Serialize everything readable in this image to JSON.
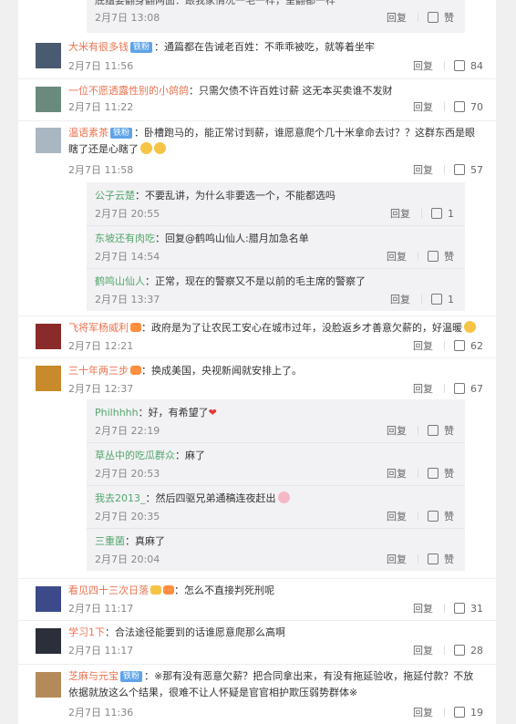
{
  "like_label": "赞",
  "reply_label": "回复",
  "top_partial": {
    "text": "底蕴要翻身翻两面：跟我家情况一毛一样，呈翻都一样",
    "date": "2月7日 13:08"
  },
  "comments": [
    {
      "name": "大米有很多钱",
      "badge": "铁粉",
      "text": "：通篇都在告诫老百姓：不乖乖被吃，就等着坐牢",
      "date": "2月7日 11:56",
      "likes": "84",
      "avatar_color": "#4a5a70"
    },
    {
      "name": "一位不愿透露性别的小鸽鸽",
      "badge": "",
      "text": "：只需欠债不许百姓讨薪 这无本买卖谁不发财",
      "date": "2月7日 11:22",
      "likes": "70",
      "avatar_color": "#6a8a7e"
    },
    {
      "name": "温语素茶",
      "badge": "铁粉",
      "text": "：卧槽跑马的，能正常讨到薪，谁愿意爬个几十米拿命去讨？？这群东西是眼瞎了还是心瞎了",
      "date": "2月7日 11:58",
      "likes": "57",
      "avatar_color": "#a9b7c2"
    },
    {
      "name": "飞将军杨威利",
      "badge": "",
      "text": "：政府是为了让农民工安心在城市过年，没脸返乡才善意欠薪的，好温暖",
      "date": "2月7日 12:21",
      "likes": "62",
      "avatar_color": "#8b2a2a"
    },
    {
      "name": "三十年两三步",
      "badge": "",
      "text": "：换成美国，央视新闻就安排上了。",
      "date": "2月7日 12:37",
      "likes": "67",
      "avatar_color": "#c88a2a"
    },
    {
      "name": "看见四十三次日落",
      "badge": "",
      "text": "：怎么不直接判死刑呢",
      "date": "2月7日 11:17",
      "likes": "31",
      "avatar_color": "#3c4a8a"
    },
    {
      "name": "学习1下",
      "badge": "",
      "text": "：合法途径能要到的话谁愿意爬那么高啊",
      "date": "2月7日 11:17",
      "likes": "28",
      "avatar_color": "#2a2f3a"
    },
    {
      "name": "芝麻与元宝",
      "badge": "铁粉",
      "text": "：※那有没有恶意欠薪？把合同拿出来，有没有拖延验收，拖延付款？不放依据就放这么个结果，很难不让人怀疑是官官相护欺压弱势群体※",
      "date": "2月7日 11:36",
      "likes": "19",
      "avatar_color": "#b48a5a"
    }
  ],
  "replies_a": [
    {
      "name": "公子云楚",
      "text": "：不要乱讲，为什么非要选一个，不能都选吗",
      "date": "2月7日 20:55",
      "likes": "1"
    },
    {
      "name": "东坡还有肉吃",
      "text": "：回复@鹤鸣山仙人:腊月加急名单",
      "date": "2月7日 14:54",
      "likes": "赞"
    },
    {
      "name": "鹤鸣山仙人",
      "text": "：正常，现在的警察又不是以前的毛主席的警察了",
      "date": "2月7日 13:37",
      "likes": "1"
    }
  ],
  "replies_b": [
    {
      "name": "Philhhhh",
      "text": "：好，有希望了",
      "date": "2月7日 22:19",
      "likes": "赞"
    },
    {
      "name": "草丛中的吃瓜群众",
      "text": "：麻了",
      "date": "2月7日 20:53",
      "likes": "赞"
    },
    {
      "name": "我去2013_",
      "text": "：然后四驱兄弟通稿连夜赶出",
      "date": "2月7日 20:35",
      "likes": "赞"
    },
    {
      "name": "三重菌",
      "text": "：真麻了",
      "date": "2月7日 20:04",
      "likes": "赞"
    }
  ]
}
